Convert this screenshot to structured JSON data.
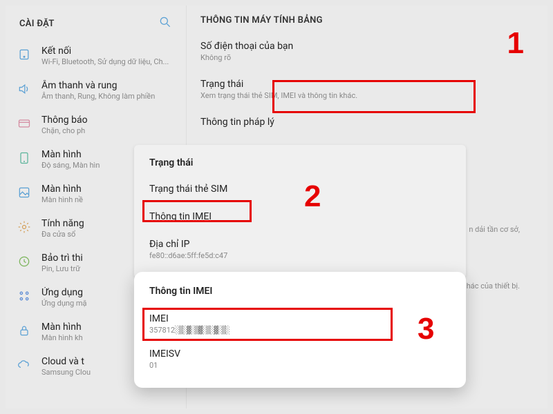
{
  "left": {
    "header": "CÀI ĐẶT",
    "items": [
      {
        "icon": "wifi-icon",
        "title": "Kết nối",
        "sub": "Wi-Fi, Bluetooth, Sử dụng dữ liệu, Ch..."
      },
      {
        "icon": "sound-icon",
        "title": "Âm thanh và rung",
        "sub": "Âm thanh, Rung, Không làm phiền"
      },
      {
        "icon": "notif-icon",
        "title": "Thông báo",
        "sub": "Chặn, cho ph"
      },
      {
        "icon": "display-icon",
        "title": "Màn hình",
        "sub": "Độ sáng, Màn hìn"
      },
      {
        "icon": "wallpaper-icon",
        "title": "Màn hình",
        "sub": "Màn hình nề"
      },
      {
        "icon": "advanced-icon",
        "title": "Tính năng",
        "sub": "Đa cửa sổ"
      },
      {
        "icon": "battery-icon",
        "title": "Bảo trì thi",
        "sub": "Pin, Lưu trữ"
      },
      {
        "icon": "apps-icon",
        "title": "Ứng dụng",
        "sub": "Ứng dụng mặ"
      },
      {
        "icon": "lock-icon",
        "title": "Màn hình",
        "sub": "Màn hình kh"
      },
      {
        "icon": "cloud-icon",
        "title": "Cloud và t",
        "sub": "Samsung Clou"
      }
    ]
  },
  "right": {
    "header": "THÔNG TIN MÁY TÍNH BẢNG",
    "rows": [
      {
        "title": "Số điện thoại của bạn",
        "sub": "Không rõ"
      },
      {
        "title": "Trạng thái",
        "sub": "Xem trạng thái thẻ SIM, IMEI và thông tin khác."
      },
      {
        "title": "Thông tin pháp lý",
        "sub": ""
      }
    ],
    "edge_text_1": "n dải tần cơ sở,",
    "edge_text_2": "hác của thiết bị."
  },
  "popup1": {
    "header": "Trạng thái",
    "rows": [
      {
        "title": "Trạng thái thẻ SIM",
        "sub": ""
      },
      {
        "title": "Thông tin IMEI",
        "sub": ""
      },
      {
        "title": "Địa chỉ IP",
        "sub": "fe80::d6ae:5ff:fe5d:c47"
      }
    ]
  },
  "popup2": {
    "header": "Thông tin IMEI",
    "rows": [
      {
        "title": "IMEI",
        "sub": "357812"
      },
      {
        "title": "IMEISV",
        "sub": "01"
      }
    ]
  },
  "annotations": {
    "n1": "1",
    "n2": "2",
    "n3": "3"
  }
}
